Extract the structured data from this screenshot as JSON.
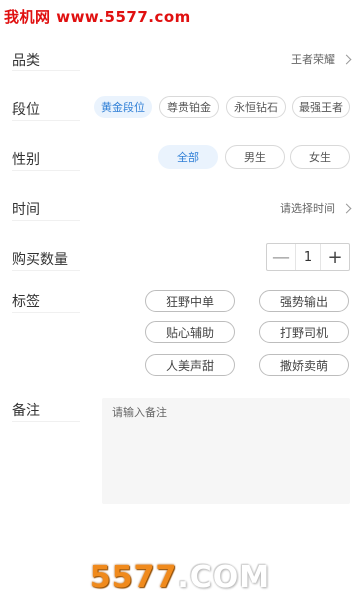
{
  "watermark": {
    "top_text": "我机网 www.5577.com",
    "bottom_prefix": "5577",
    "bottom_suffix": ".COM"
  },
  "category": {
    "label": "品类",
    "value": "王者荣耀"
  },
  "rank": {
    "label": "段位",
    "options": [
      "黄金段位",
      "尊贵铂金",
      "永恒钻石",
      "最强王者"
    ],
    "selected": "黄金段位"
  },
  "gender": {
    "label": "性别",
    "options": [
      "全部",
      "男生",
      "女生"
    ],
    "selected": "全部"
  },
  "time": {
    "label": "时间",
    "value": "请选择时间"
  },
  "quantity": {
    "label": "购买数量",
    "minus": "—",
    "value": "1",
    "plus": "+"
  },
  "tags": {
    "label": "标签",
    "items": [
      "狂野中单",
      "强势输出",
      "贴心辅助",
      "打野司机",
      "人美声甜",
      "撒娇卖萌"
    ]
  },
  "remark": {
    "label": "备注",
    "placeholder": "请输入备注"
  },
  "colors": {
    "accent": "#2f7fd6",
    "accent_bg": "#eaf3fd",
    "watermark_red": "#e01010",
    "watermark_orange": "#f08a1c"
  }
}
